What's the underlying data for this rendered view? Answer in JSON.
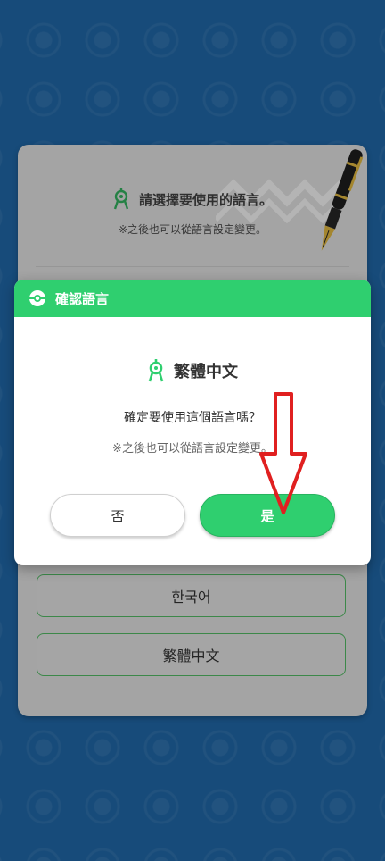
{
  "lang_card": {
    "title": "請選擇要使用的語言。",
    "note": "※之後也可以從語言設定變更。",
    "options": [
      "한국어",
      "繁體中文"
    ]
  },
  "dialog": {
    "title": "確認語言",
    "language": "繁體中文",
    "question": "確定要使用這個語言嗎？",
    "note": "※之後也可以從語言設定變更。",
    "no_label": "否",
    "yes_label": "是"
  },
  "colors": {
    "background": "#1d5c95",
    "accent_green": "#2fcf6f",
    "annotation_red": "#e02020"
  },
  "icons": {
    "dialog_header": "pokeball-icon",
    "language": "compass-icon",
    "decoration": "fountain-pen-icon"
  }
}
